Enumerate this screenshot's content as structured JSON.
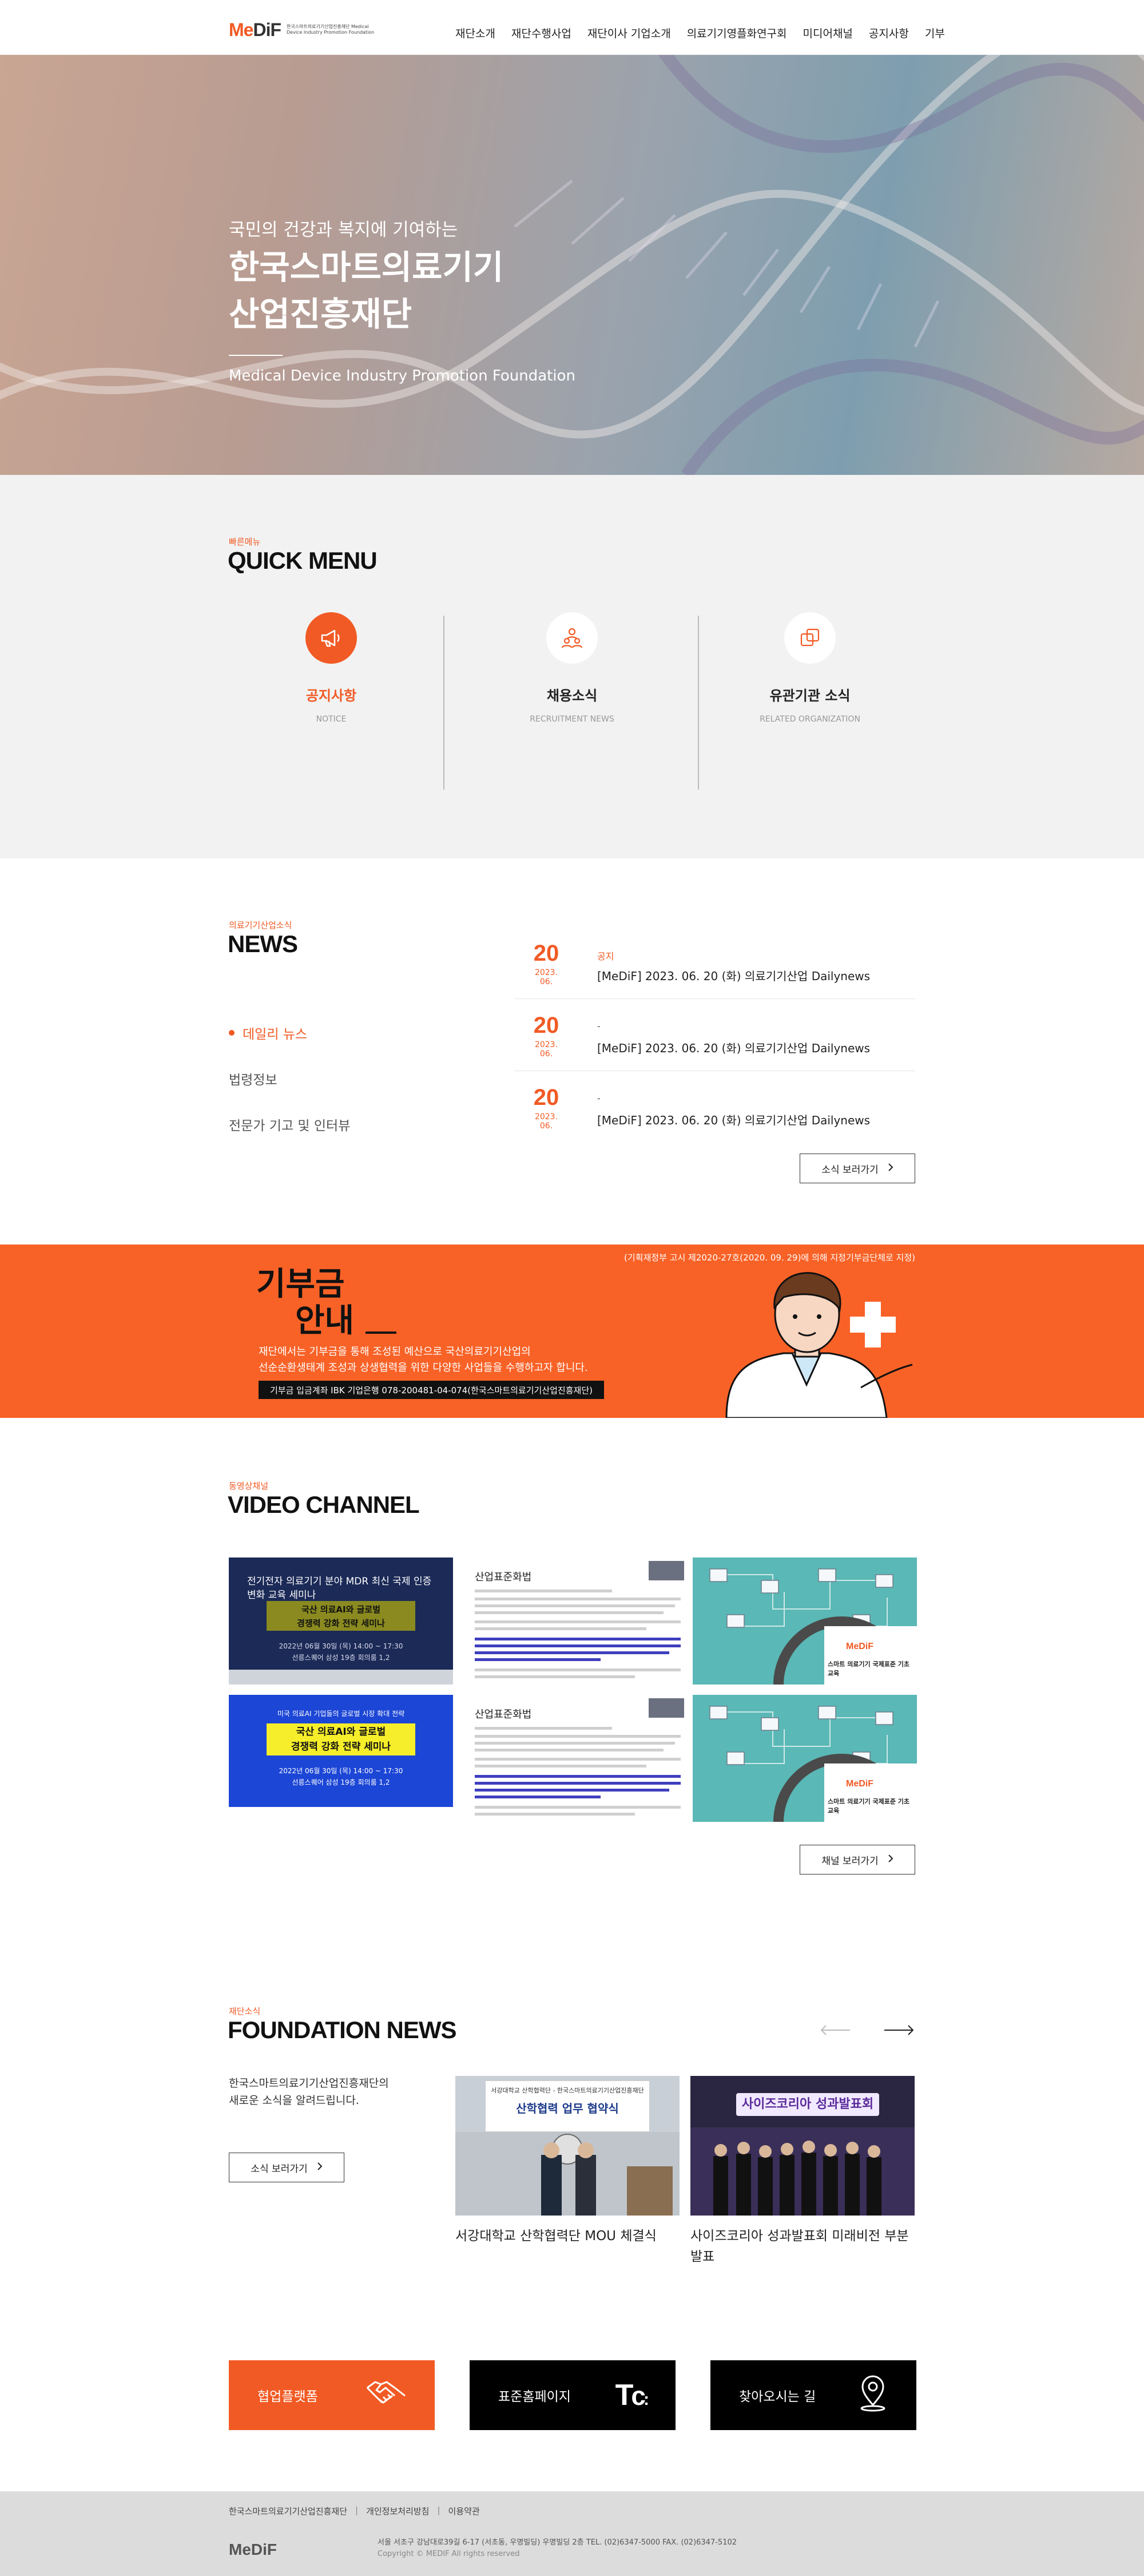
{
  "header": {
    "logo_mark_me": "Me",
    "logo_mark_dif": "DiF",
    "logo_sub": "한국스마트의료기기산업진흥재단 Medical Device Industry Promotion Foundation",
    "nav": [
      "재단소개",
      "재단수행사업",
      "재단이사 기업소개",
      "의료기기영플화연구회",
      "미디어채널",
      "공지사항",
      "기부"
    ]
  },
  "hero": {
    "subtitle": "국민의 건강과 복지에 기여하는",
    "title_line1": "한국스마트의료기기",
    "title_line2": "산업진흥재단",
    "english": "Medical Device Industry Promotion Foundation"
  },
  "quick_menu": {
    "small": "빠른메뉴",
    "title": "QUICK MENU",
    "items": [
      {
        "label": "공지사항",
        "en": "NOTICE",
        "icon": "megaphone-icon"
      },
      {
        "label": "채용소식",
        "en": "RECRUITMENT NEWS",
        "icon": "people-icon"
      },
      {
        "label": "유관기관 소식",
        "en": "RELATED ORGANIZATION",
        "icon": "squares-icon"
      }
    ],
    "accent": "#f15a24"
  },
  "news": {
    "small": "의료기기산업소식",
    "title": "NEWS",
    "categories": [
      "데일리 뉴스",
      "법령정보",
      "전문가 기고 및 인터뷰"
    ],
    "items": [
      {
        "day": "20",
        "ym": "2023. 06.",
        "tag": "공지",
        "text": "[MeDiF] 2023. 06. 20 (화) 의료기기산업 Dailynews"
      },
      {
        "day": "20",
        "ym": "2023. 06.",
        "tag": "-",
        "text": "[MeDiF] 2023. 06. 20 (화) 의료기기산업 Dailynews"
      },
      {
        "day": "20",
        "ym": "2023. 06.",
        "tag": "-",
        "text": "[MeDiF] 2023. 06. 20 (화) 의료기기산업 Dailynews"
      }
    ],
    "more": "소식 보러가기"
  },
  "donation": {
    "note": "(기획재정부 고시 제2020-27호(2020. 09. 29)에 의해 지정기부금단체로 지정)",
    "title_line1": "기부금",
    "title_line2": "안내",
    "desc_line1": "재단에서는 기부금을 통해 조성된 예산으로 국산의료기기산업의",
    "desc_line2": "선순순환생태계 조성과 상생협력을 위한 다양한 사업들을 수행하고자 합니다.",
    "account": "기부금 입금계좌 IBK 기업은행 078-200481-04-074(한국스마트의료기기산업진흥재단)"
  },
  "video": {
    "small": "동영상채널",
    "title": "VIDEO CHANNEL",
    "thumbs": [
      {
        "type": "seminar-dark",
        "line1": "전기전자 의료기기 분야 MDR 최신 국제 인증",
        "line2": "변화 교육 세미나",
        "box1": "국산 의료AI와 글로벌",
        "box2": "경쟁력 강화 전략 세미나",
        "date": "2022년 06월 30일 (목) 14:00 ~ 17:30",
        "place": "선릉스퀘어 삼성 19층 회의룸 1,2"
      },
      {
        "type": "document",
        "title": "산업표준화법"
      },
      {
        "type": "teal",
        "caption": "스마트 의료기기 국제표준 기초교육"
      },
      {
        "type": "seminar-blue",
        "line1": "미국 의료AI 기업들의 글로벌 시장 확대 전략",
        "box1": "국산 의료AI와 글로벌",
        "box2": "경쟁력 강화 전략 세미나",
        "date": "2022년 06월 30일 (목) 14:00 ~ 17:30",
        "place": "선릉스퀘어 삼성 19층 회의룸 1,2"
      },
      {
        "type": "document",
        "title": "산업표준화법"
      },
      {
        "type": "teal",
        "caption": "스마트 의료기기 국제표준 기초교육"
      }
    ],
    "more": "채널 보러가기"
  },
  "foundation_news": {
    "small": "재단소식",
    "title": "FOUNDATION NEWS",
    "desc_line1": "한국스마트의료기기산업진흥재단의",
    "desc_line2": "새로운 소식을 알려드립니다.",
    "more": "소식 보러가기",
    "items": [
      {
        "caption": "서강대학교 산학협력단 MOU 체결식",
        "banner": "서강대학교 산학협력단 - 한국스마트의료기기산업진흥재단",
        "banner2": "산학협력 업무 협약식"
      },
      {
        "caption": "사이즈코리아 성과발표회 미래비전 부분 발표",
        "banner": "사이즈코리아 성과발표회"
      }
    ]
  },
  "links": [
    {
      "label": "협업플랫폼",
      "icon": "handshake-icon",
      "bg": "#f15a24"
    },
    {
      "label": "표준홈페이지",
      "icon": "tc-logo-icon",
      "bg": "#000000"
    },
    {
      "label": "찾아오시는 길",
      "icon": "map-pin-icon",
      "bg": "#000000"
    }
  ],
  "footer": {
    "links": [
      "한국스마트의료기기산업진흥재단",
      "개인정보처리방침",
      "이용약관"
    ],
    "logo": "MeDiF",
    "address": "서울 서초구 강남대로39길 6-17 (서초동, 우명빌딩) 우명빌딩 2층 TEL. (02)6347-5000  FAX. (02)6347-5102",
    "copyright": "Copyright © MEDIF All rights reserved"
  }
}
